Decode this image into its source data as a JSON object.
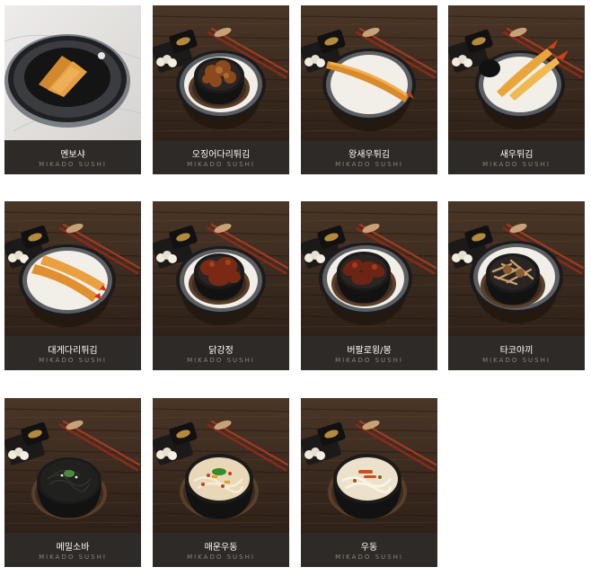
{
  "menu": {
    "items": [
      {
        "name": "멘보샤",
        "brand": "MIKADO SUSHI",
        "food": "menbosha",
        "bg": "marble"
      },
      {
        "name": "오징어다리튀김",
        "brand": "MIKADO SUSHI",
        "food": "squid",
        "bg": "wood"
      },
      {
        "name": "왕새우튀김",
        "brand": "MIKADO SUSHI",
        "food": "big-shrimp",
        "bg": "wood"
      },
      {
        "name": "새우튀김",
        "brand": "MIKADO SUSHI",
        "food": "shrimp",
        "bg": "wood"
      },
      {
        "name": "대게다리튀김",
        "brand": "MIKADO SUSHI",
        "food": "crab-leg",
        "bg": "wood"
      },
      {
        "name": "닭강정",
        "brand": "MIKADO SUSHI",
        "food": "chicken",
        "bg": "wood"
      },
      {
        "name": "버팔로윙/봉",
        "brand": "MIKADO SUSHI",
        "food": "wings",
        "bg": "wood"
      },
      {
        "name": "타코야끼",
        "brand": "MIKADO SUSHI",
        "food": "takoyaki",
        "bg": "wood"
      },
      {
        "name": "메밀소바",
        "brand": "MIKADO SUSHI",
        "food": "soba",
        "bg": "wood"
      },
      {
        "name": "매운우동",
        "brand": "MIKADO SUSHI",
        "food": "spicy-udon",
        "bg": "wood"
      },
      {
        "name": "우동",
        "brand": "MIKADO SUSHI",
        "food": "udon",
        "bg": "wood"
      }
    ]
  },
  "colors": {
    "caption_bg": "#2d2a27",
    "caption_text": "#ffffff",
    "brand_text": "#8d8478",
    "wood_dark": "#3a2a1f",
    "wood_light": "#6b4d36"
  }
}
